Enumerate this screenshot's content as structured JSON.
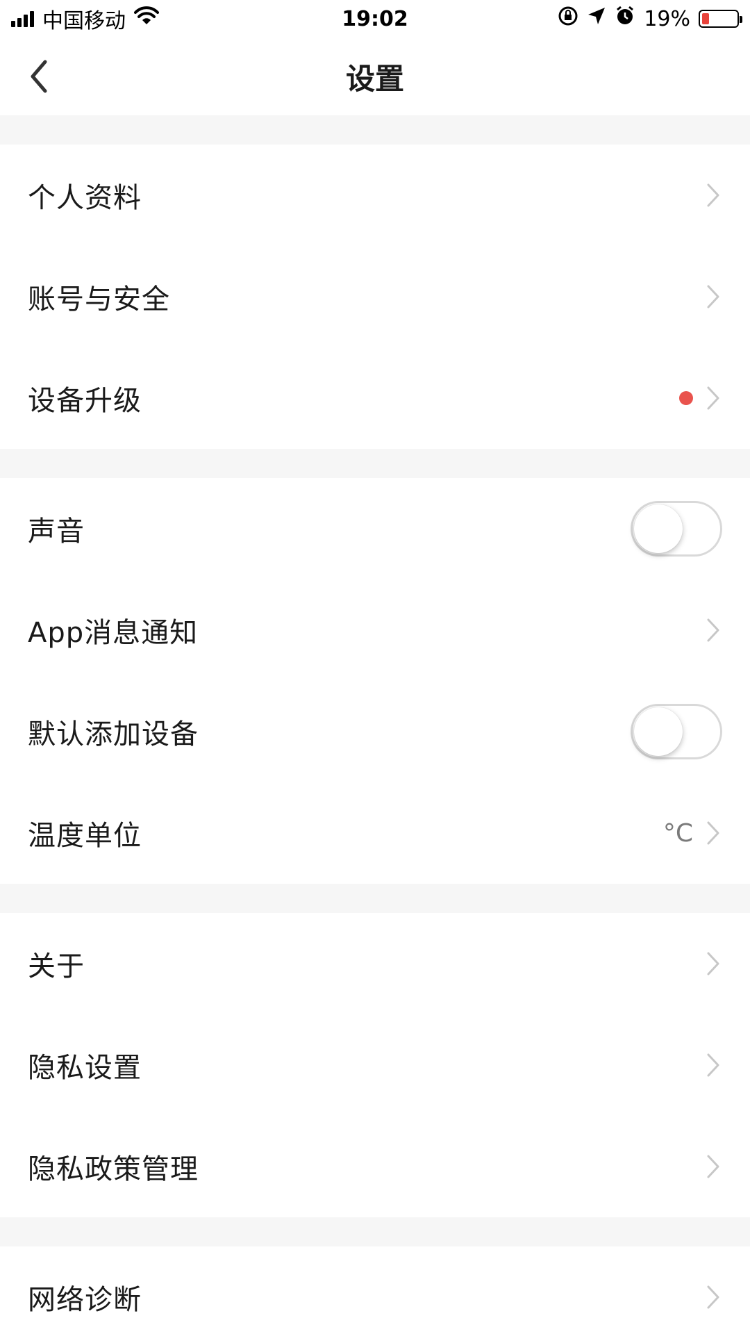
{
  "status_bar": {
    "carrier": "中国移动",
    "time": "19:02",
    "battery_percent": "19%",
    "battery_level": 0.19,
    "icons": [
      "signal-icon",
      "wifi-icon",
      "orientation-lock-icon",
      "location-arrow-icon",
      "alarm-icon",
      "battery-icon"
    ]
  },
  "nav": {
    "title": "设置",
    "back_icon": "chevron-left-icon"
  },
  "sections": [
    {
      "items": [
        {
          "label": "个人资料",
          "control": "chevron"
        },
        {
          "label": "账号与安全",
          "control": "chevron"
        },
        {
          "label": "设备升级",
          "control": "chevron",
          "badge": "dot"
        }
      ]
    },
    {
      "items": [
        {
          "label": "声音",
          "control": "toggle",
          "state": false
        },
        {
          "label": "App消息通知",
          "control": "chevron"
        },
        {
          "label": "默认添加设备",
          "control": "toggle",
          "state": false
        },
        {
          "label": "温度单位",
          "control": "chevron",
          "value": "°C"
        }
      ]
    },
    {
      "items": [
        {
          "label": "关于",
          "control": "chevron"
        },
        {
          "label": "隐私设置",
          "control": "chevron"
        },
        {
          "label": "隐私政策管理",
          "control": "chevron"
        }
      ]
    },
    {
      "items": [
        {
          "label": "网络诊断",
          "control": "chevron"
        }
      ]
    }
  ],
  "colors": {
    "accent_dot": "#e9534d",
    "battery_low": "#e8433b",
    "section_gap": "#f6f6f6",
    "chevron": "#c7c7c7"
  }
}
